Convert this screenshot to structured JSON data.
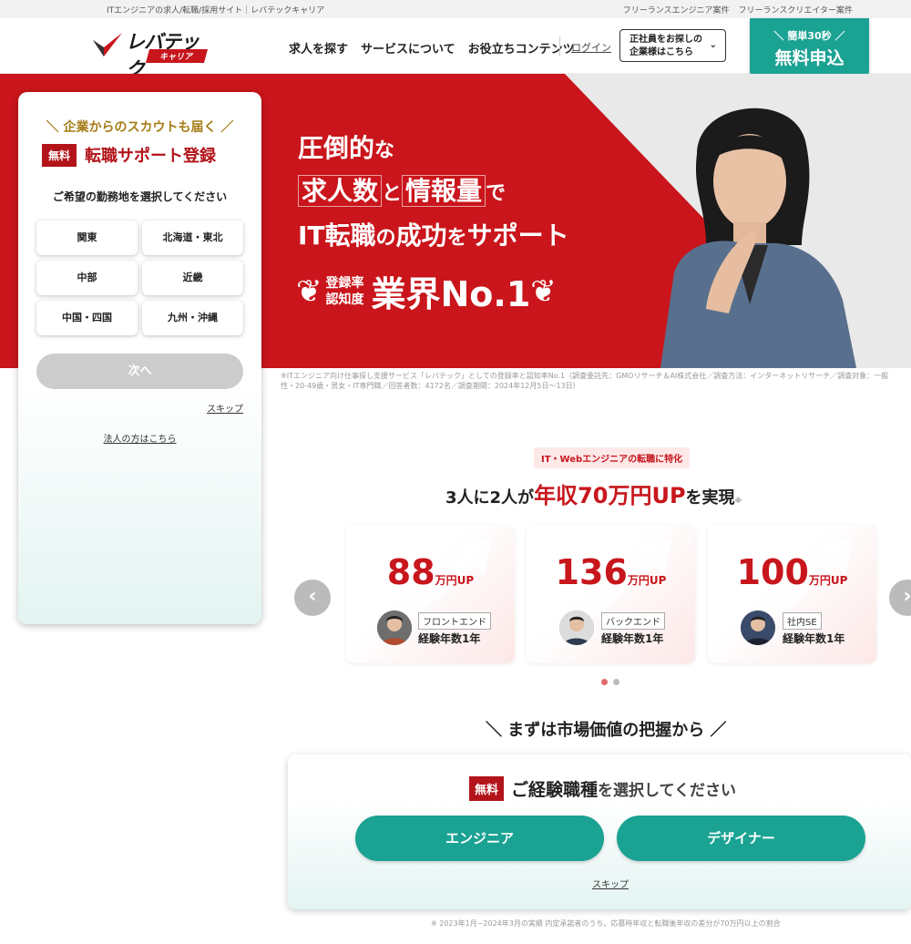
{
  "top_strip": {
    "left_text": "ITエンジニアの求人/転職/採用サイト｜レバテックキャリア",
    "links": [
      "フリーランスエンジニア案件",
      "フリーランスクリエイター案件"
    ]
  },
  "header": {
    "logo_name": "レバテック",
    "logo_sub": "キャリア",
    "nav": [
      "求人を探す",
      "サービスについて",
      "お役立ちコンテンツ"
    ],
    "login": "ログイン",
    "corp_button_line1": "正社員をお探しの",
    "corp_button_line2": "企業様はこちら",
    "cta_small": "＼ 簡単30秒 ／",
    "cta_big": "無料申込"
  },
  "hero": {
    "line1_a": "圧倒的",
    "line1_b": "な",
    "line2_a": "求人数",
    "line2_b": "と",
    "line2_c": "情報量",
    "line2_d": "で",
    "line3_a": "IT転職",
    "line3_b": "の",
    "line3_c": "成功",
    "line3_d": "を",
    "line3_e": "サポート",
    "award_line1": "登録率",
    "award_line2": "認知度",
    "award_main": "業界No.1",
    "footnote_1": "※ITエンジニア向け仕事探し支援サービス「レバテック」としての登録率と認知率No.1（調査委託先：GMOリサーチ＆AI株式会社／調査方法：インターネットリサーチ／調査対象：一般",
    "footnote_2": "性・20-49歳・男女・IT専門職／回答者数：4172名／調査期間：2024年12月5日〜13日）"
  },
  "form": {
    "scout": "＼ 企業からのスカウトも届く ／",
    "badge": "無料",
    "title": "転職サポート登録",
    "question": "ご希望の勤務地を選択してください",
    "regions": [
      "関東",
      "北海道・東北",
      "中部",
      "近畿",
      "中国・四国",
      "九州・沖縄"
    ],
    "next": "次へ",
    "skip": "スキップ",
    "corp_link": "法人の方はこちら"
  },
  "results": {
    "tag": "IT・Webエンジニアの転職に特化",
    "title_a": "3人に2人が",
    "title_hl": "年収70万円UP",
    "title_b": "を実現",
    "asterisk": "※",
    "unit": "万円UP",
    "cards": [
      {
        "amount": "88",
        "role": "フロントエンド",
        "exp": "経験年数1年"
      },
      {
        "amount": "136",
        "role": "バックエンド",
        "exp": "経験年数1年"
      },
      {
        "amount": "100",
        "role": "社内SE",
        "exp": "経験年数1年"
      }
    ],
    "prev_icon": "‹",
    "next_icon": "›"
  },
  "market": {
    "title": "＼ まずは市場価値の把握から ／",
    "badge": "無料",
    "question_a": "ご経験",
    "question_b": "職種",
    "question_c": "を選択してください",
    "engineer": "エンジニア",
    "designer": "デザイナー",
    "skip": "スキップ"
  },
  "bottom_note": "※ 2023年1月~2024年3月の実績 内定承諾者のうち、応募時年収と転職後年収の差分が70万円以上の割合"
}
